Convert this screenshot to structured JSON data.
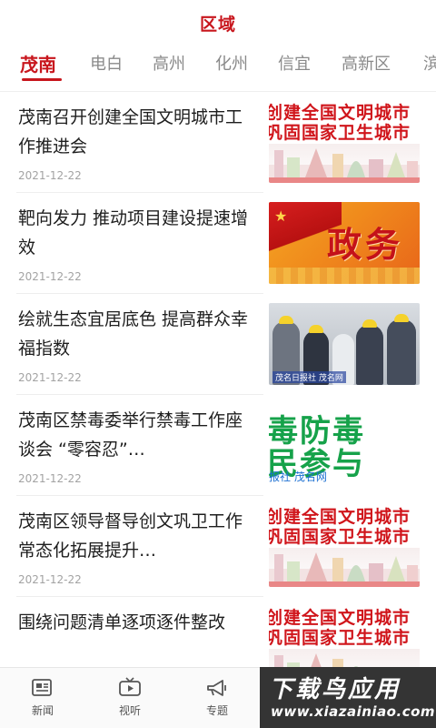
{
  "header": {
    "title": "区域"
  },
  "tabs": [
    {
      "label": "茂南",
      "active": true
    },
    {
      "label": "电白",
      "active": false
    },
    {
      "label": "高州",
      "active": false
    },
    {
      "label": "化州",
      "active": false
    },
    {
      "label": "信宜",
      "active": false
    },
    {
      "label": "高新区",
      "active": false
    },
    {
      "label": "滨",
      "active": false
    }
  ],
  "news": [
    {
      "title": "茂南召开创建全国文明城市工作推进会",
      "date": "2021-12-22",
      "thumb": "civilization-city-banner"
    },
    {
      "title": "靶向发力 推动项目建设提速增效",
      "date": "2021-12-22",
      "thumb": "government-affairs-banner"
    },
    {
      "title": "绘就生态宜居底色 提高群众幸福指数",
      "date": "2021-12-22",
      "thumb": "inspection-photo"
    },
    {
      "title": "茂南区禁毒委举行禁毒工作座谈会 “零容忍”…",
      "date": "2021-12-22",
      "thumb": "anti-drug-banner"
    },
    {
      "title": "茂南区领导督导创文巩卫工作 常态化拓展提升…",
      "date": "2021-12-22",
      "thumb": "civilization-city-banner"
    },
    {
      "title": "围绕问题清单逐项逐件整改",
      "date": "",
      "thumb": "civilization-city-banner"
    }
  ],
  "thumb_text": {
    "civil_line1": "创建全国文明城市",
    "civil_line2": "巩固国家卫生城市",
    "gov_word": "政务",
    "photo_caption": "茂名日报社 茂名网",
    "drug_line1": "毒防毒",
    "drug_line2": "民参与",
    "drug_line3": "报社 茂名网"
  },
  "bottom_nav": [
    {
      "label": "新闻",
      "icon": "newspaper-icon"
    },
    {
      "label": "视听",
      "icon": "tv-icon"
    },
    {
      "label": "专题",
      "icon": "megaphone-icon"
    }
  ],
  "watermark": {
    "main": "下载鸟应用",
    "sub": "www.xiazainiao.com"
  },
  "colors": {
    "accent": "#c8161d",
    "muted": "#8a8a8a",
    "date": "#a3a3a3",
    "drug_green": "#16a24a"
  }
}
